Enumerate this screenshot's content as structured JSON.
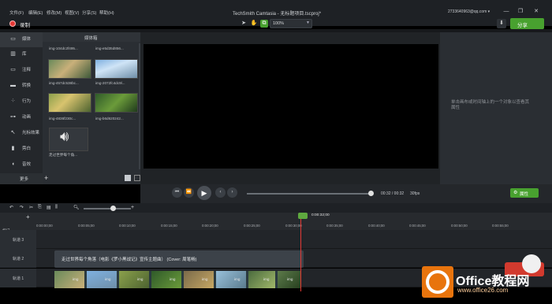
{
  "window": {
    "menu": [
      "文件(F)",
      "编辑(E)",
      "修改(M)",
      "视图(V)",
      "分享(S)",
      "帮助(H)"
    ],
    "title": "TechSmith Camtasia - 无标题项目.tscproj*",
    "account": "2733640963@qq.com ▾",
    "controls": [
      "—",
      "❐",
      "✕"
    ]
  },
  "toolbar": {
    "record_label": "录制",
    "zoom_value": "100%",
    "share_label": "分享"
  },
  "sidebar": {
    "items": [
      {
        "label": "媒体",
        "icon": "film-icon"
      },
      {
        "label": "库",
        "icon": "library-icon"
      },
      {
        "label": "注释",
        "icon": "annotation-icon"
      },
      {
        "label": "转换",
        "icon": "transition-icon"
      },
      {
        "label": "行为",
        "icon": "behavior-icon"
      },
      {
        "label": "动画",
        "icon": "animation-icon"
      },
      {
        "label": "光标效果",
        "icon": "cursor-icon"
      },
      {
        "label": "旁白",
        "icon": "mic-icon"
      },
      {
        "label": "音效",
        "icon": "audio-icon"
      }
    ],
    "more_label": "更多",
    "add_label": "+"
  },
  "media_bin": {
    "title": "媒体箱",
    "items": [
      {
        "name": "img-104dc2f495..."
      },
      {
        "name": "img-e5d35d856..."
      },
      {
        "name": "img-457dc538bc..."
      },
      {
        "name": "img-2072fc4dc9l..."
      },
      {
        "name": "img-4836f230c..."
      },
      {
        "name": "img-b6d620242..."
      }
    ],
    "audio_item": "走过世界每个角..."
  },
  "properties": {
    "message": "单击画布或时间轴上的一个对象以查看其属性"
  },
  "transport": {
    "timecode": "00:32 / 00:32",
    "fps": "30fps",
    "props_label": "属性"
  },
  "timeline": {
    "playhead_time": "0:00:32;00",
    "ticks": [
      "0:00:00;00",
      "0:00:05;00",
      "0:00:10;00",
      "0:00:15;00",
      "0:00:20;00",
      "0:00:25;00",
      "0:00:30;00",
      "0:00:35;00",
      "0:00:40;00",
      "0:00:45;00",
      "0:00:50;00",
      "0:00:55;00"
    ],
    "header_label": "标记",
    "tracks": [
      "轨道 3",
      "轨道 2",
      "轨道 1"
    ],
    "audio_clip_title": "走过世界每个角落（电影《罗小黑战记》宣传主题曲） (Cover: 周笔畅)",
    "clip_labels": [
      "img",
      "img",
      "img",
      "img",
      "img",
      "img",
      "img",
      "img"
    ]
  },
  "watermark": {
    "title": "Office教程网",
    "url": "www.office26.com"
  }
}
